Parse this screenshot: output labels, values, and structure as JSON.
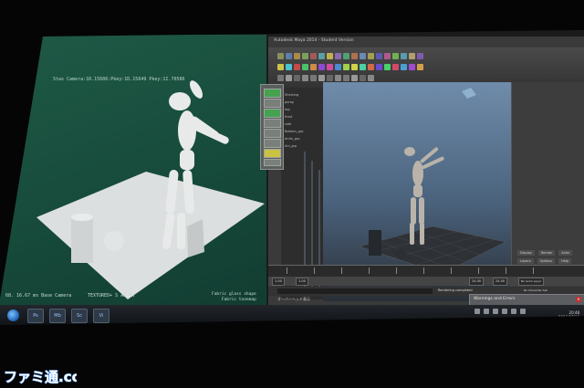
{
  "left_viewport": {
    "hud_top": "Stas Camera:1R.15686:Pkey:1D.15649 Pkey:1I.70586",
    "hud_camera": "68. 16.67 ms  Base Camera",
    "hud_mode": "TEXTURED+ S AA ON",
    "hud_right_line1": "Fabric glass shape",
    "hud_right_line2": "Fabric toonmap"
  },
  "maya": {
    "title": "Autodesk Maya 2014 - Student Version",
    "outliner_items": [
      "Shelving",
      "persp",
      "top",
      "front",
      "side",
      "Bottom_grp",
      "Anim_grp",
      "Ani_grp"
    ],
    "right_tabs": [
      "Display",
      "Render",
      "Anim"
    ],
    "right_subtabs": [
      "Layers",
      "Options",
      "Help"
    ],
    "range_start": "1.00",
    "range_end": "24.00",
    "range_field2": "24.00",
    "anim_layer": "No Anim Layer",
    "char_set": "No Character Set",
    "help_text": "オーバーヘッド表示",
    "status_text": "Rendering completed"
  },
  "popup": {
    "title": "Warnings and Errors"
  },
  "taskbar": {
    "apps": [
      "Ps",
      "Mb",
      "Sc",
      "Vi"
    ],
    "clock_time": "20:48",
    "clock_date": "2013/07/16"
  },
  "watermark": {
    "text": "ファミ通.com"
  },
  "colors": {
    "left_bg": "#1f5a46",
    "viewport_sky": "#6f8caa",
    "accent_green": "#45a350",
    "taskbar": "#15191e"
  },
  "icons": [
    "windows-start-icon",
    "maya-shelf-icons",
    "close-icon"
  ]
}
